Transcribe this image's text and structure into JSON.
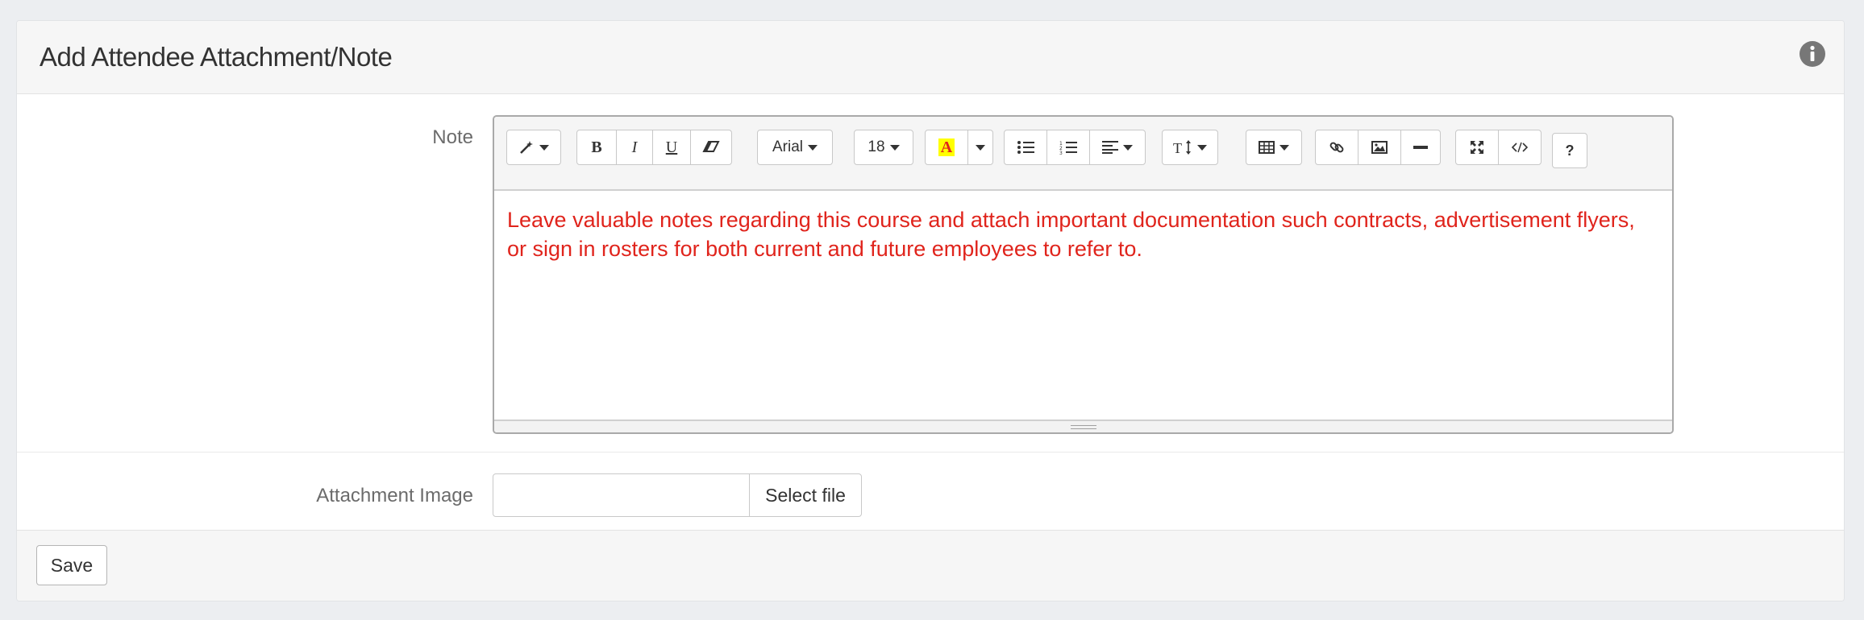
{
  "panel": {
    "title": "Add Attendee Attachment/Note",
    "info_icon": "info-circle-icon"
  },
  "note": {
    "label": "Note",
    "content": "Leave valuable notes regarding this course and attach important documentation such contracts, advertisement flyers, or sign in rosters for both current and future employees to refer to.",
    "content_color": "#e0241c"
  },
  "toolbar": {
    "bold": "B",
    "italic": "I",
    "underline": "U",
    "font_name": "Arial",
    "font_size": "18",
    "color_letter": "A",
    "highlight_color": "#ffff00",
    "text_color": "#e0241c",
    "help": "?"
  },
  "attachment": {
    "label": "Attachment Image",
    "value": "",
    "button_label": "Select file"
  },
  "footer": {
    "save_label": "Save"
  }
}
